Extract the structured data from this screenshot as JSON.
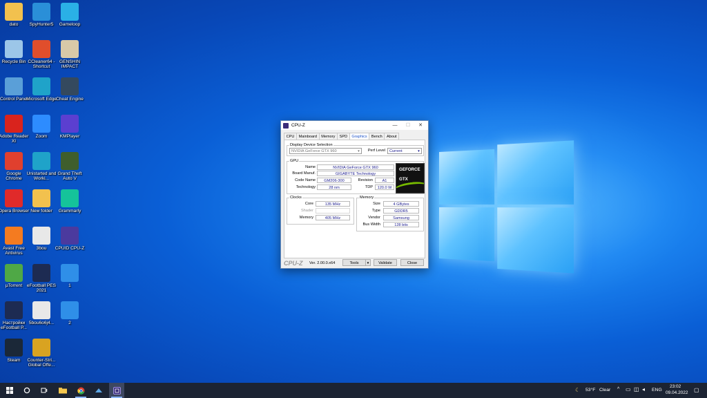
{
  "desktop": {
    "icons": [
      {
        "label": "dato",
        "icon": "folder-icon",
        "color": "#f2c14e"
      },
      {
        "label": "SpyHunter5",
        "icon": "spyhunter-icon",
        "color": "#2a8fd8"
      },
      {
        "label": "Gameloop",
        "icon": "gameloop-icon",
        "color": "#2ab0e6"
      },
      {
        "label": "Recycle Bin",
        "icon": "recycle-bin-icon",
        "color": "#9cc6e8"
      },
      {
        "label": "CCleaner64 - Shortcut",
        "icon": "ccleaner-icon",
        "color": "#e04e2c"
      },
      {
        "label": "GENSHIN IMPACT",
        "icon": "genshin-icon",
        "color": "#d8c9a8"
      },
      {
        "label": "Control Panel",
        "icon": "control-panel-icon",
        "color": "#5a9fd8"
      },
      {
        "label": "Microsoft Edge",
        "icon": "edge-icon",
        "color": "#1fa3c9"
      },
      {
        "label": "Cheat Engine",
        "icon": "cheat-engine-icon",
        "color": "#34495e"
      },
      {
        "label": "Adobe Reader XI",
        "icon": "adobe-reader-icon",
        "color": "#d9231d"
      },
      {
        "label": "Zoom",
        "icon": "zoom-icon",
        "color": "#2d8cff"
      },
      {
        "label": "KMPlayer",
        "icon": "kmplayer-icon",
        "color": "#5b3fd0"
      },
      {
        "label": "Google Chrome",
        "icon": "chrome-icon",
        "color": "#e0402e"
      },
      {
        "label": "Unistarted and Worki...",
        "icon": "edge-icon",
        "color": "#1fa3c9"
      },
      {
        "label": "Grand Theft Auto V",
        "icon": "gta-icon",
        "color": "#3f5e2c"
      },
      {
        "label": "Opera Browser",
        "icon": "opera-icon",
        "color": "#e02a2a"
      },
      {
        "label": "New folder",
        "icon": "folder-icon",
        "color": "#f2c14e"
      },
      {
        "label": "Grammarly",
        "icon": "grammarly-icon",
        "color": "#15c39a"
      },
      {
        "label": "Avast Free Antivirus",
        "icon": "avast-icon",
        "color": "#f47b20"
      },
      {
        "label": "3bou",
        "icon": "pdf-icon",
        "color": "#e8e8e8"
      },
      {
        "label": "CPUID CPU-Z",
        "icon": "cpuz-icon",
        "color": "#4b3a9e"
      },
      {
        "label": "µTorrent",
        "icon": "utorrent-icon",
        "color": "#4fa846"
      },
      {
        "label": "eFootball PES 2021",
        "icon": "pes-icon",
        "color": "#1d2b52"
      },
      {
        "label": "1",
        "icon": "window-icon",
        "color": "#2f8fe8"
      },
      {
        "label": "Настройки eFootball P...",
        "icon": "pes-settings-icon",
        "color": "#1d2b52"
      },
      {
        "label": "5bou6o6j4...",
        "icon": "pdf-icon",
        "color": "#e8e8e8"
      },
      {
        "label": "2",
        "icon": "window-icon",
        "color": "#2f8fe8"
      },
      {
        "label": "Steam",
        "icon": "steam-icon",
        "color": "#1b2838"
      },
      {
        "label": "Counter-Stri... Global Offe...",
        "icon": "csgo-icon",
        "color": "#d9a321"
      }
    ]
  },
  "cpuz": {
    "title": "CPU-Z",
    "controls": {
      "minimize": "—",
      "maximize": "☐",
      "close": "✕"
    },
    "tabs": [
      "CPU",
      "Mainboard",
      "Memory",
      "SPD",
      "Graphics",
      "Bench",
      "About"
    ],
    "active_tab": "Graphics",
    "display_selection": {
      "group_title": "Display Device Selection",
      "device": "NVIDIA GeForce GTX 960",
      "perf_label": "Perf Level",
      "perf_value": "Current"
    },
    "gpu": {
      "group_title": "GPU",
      "name_label": "Name",
      "name": "NVIDIA GeForce GTX 960",
      "board_label": "Board Manuf.",
      "board": "GIGABYTE Technology",
      "code_label": "Code Name",
      "code": "GM206-300",
      "revision_label": "Revision",
      "revision": "A1",
      "tech_label": "Technology",
      "tech": "28 nm",
      "tdp_label": "TDP",
      "tdp": "120.0 W",
      "badge_line1": "GEFORCE",
      "badge_line2": "GTX"
    },
    "clocks": {
      "group_title": "Clocks",
      "core_label": "Core",
      "core": "135 MHz",
      "shader_label": "Shader",
      "shader": "",
      "memory_label": "Memory",
      "memory": "405 MHz"
    },
    "memory": {
      "group_title": "Memory",
      "size_label": "Size",
      "size": "4 GBytes",
      "type_label": "Type",
      "type": "GDDR5",
      "vendor_label": "Vendor",
      "vendor": "Samsung",
      "bus_label": "Bus Width",
      "bus": "128 bits"
    },
    "footer": {
      "brand": "CPU-Z",
      "version": "Ver. 2.00.0.x64",
      "tools": "Tools",
      "validate": "Validate",
      "close": "Close"
    }
  },
  "taskbar": {
    "weather_temp": "53°F",
    "weather_text": "Clear",
    "language": "ENG",
    "time": "23:02",
    "date": "09.04.2022"
  }
}
